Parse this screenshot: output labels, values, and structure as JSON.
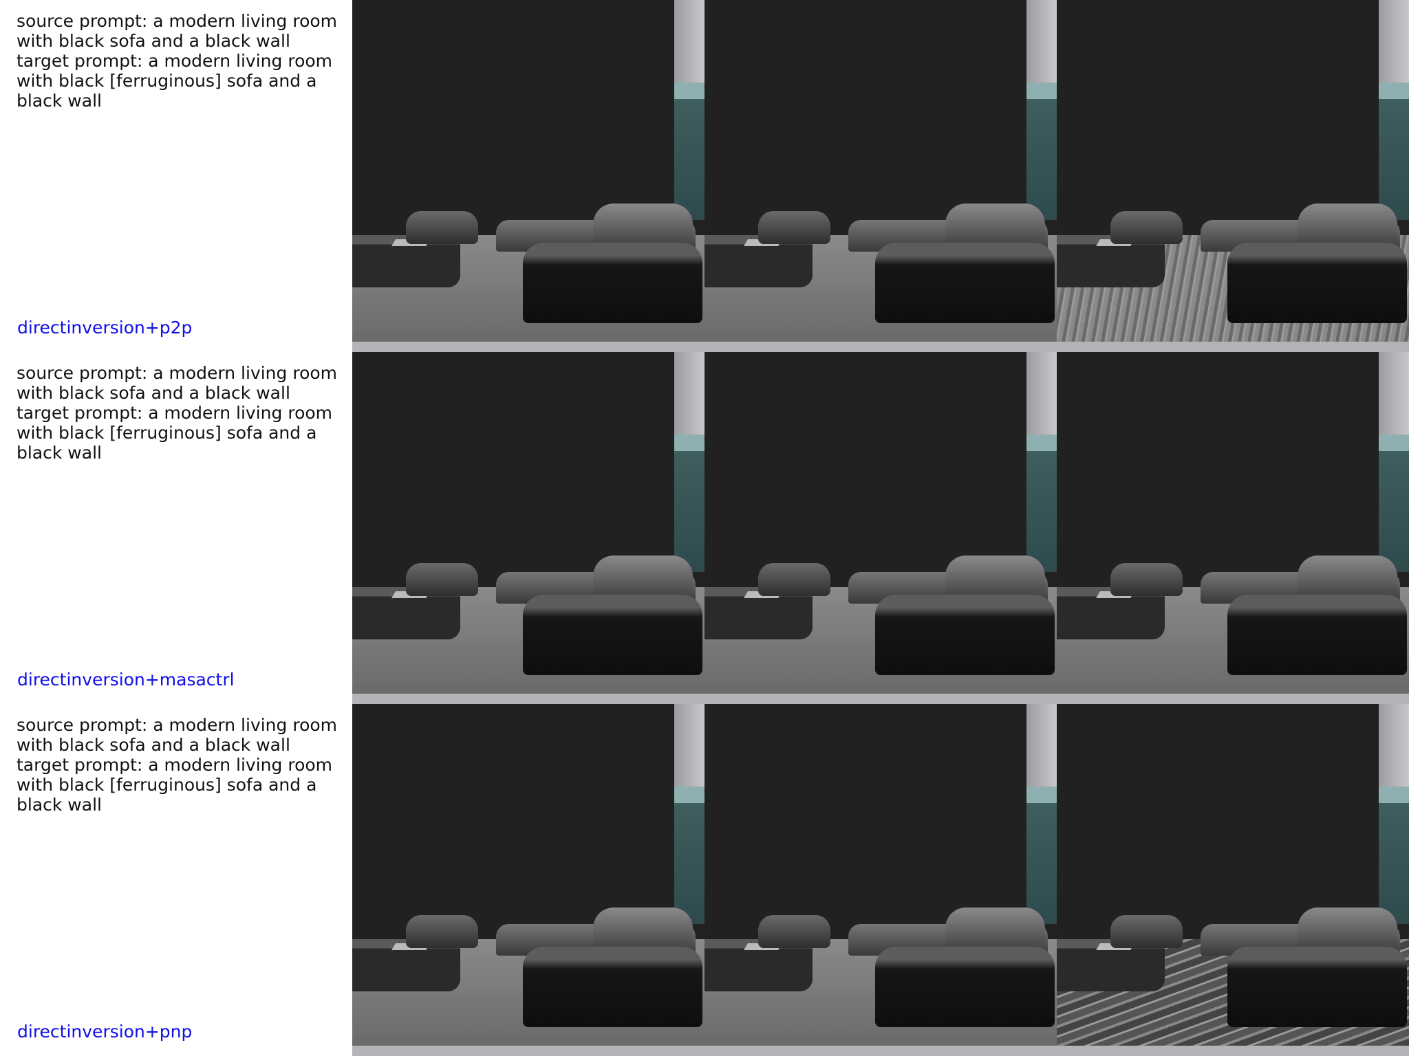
{
  "rows": [
    {
      "source_prompt": "source prompt: a modern living room with black sofa and a black wall",
      "target_prompt": "target prompt: a modern living room with black [ferruginous] sofa and a black wall",
      "method": "directinversion+p2p",
      "third_floor_style": "rug"
    },
    {
      "source_prompt": "source prompt: a modern living room with black sofa and a black wall",
      "target_prompt": "target prompt: a modern living room with black [ferruginous] sofa and a black wall",
      "method": "directinversion+masactrl",
      "third_floor_style": "plain"
    },
    {
      "source_prompt": "source prompt: a modern living room with black sofa and a black wall",
      "target_prompt": "target prompt: a modern living room with black [ferruginous] sofa and a black wall",
      "method": "directinversion+pnp",
      "third_floor_style": "marble"
    }
  ],
  "colors": {
    "method_label": "#1010e8",
    "prompt_text": "#111111"
  }
}
